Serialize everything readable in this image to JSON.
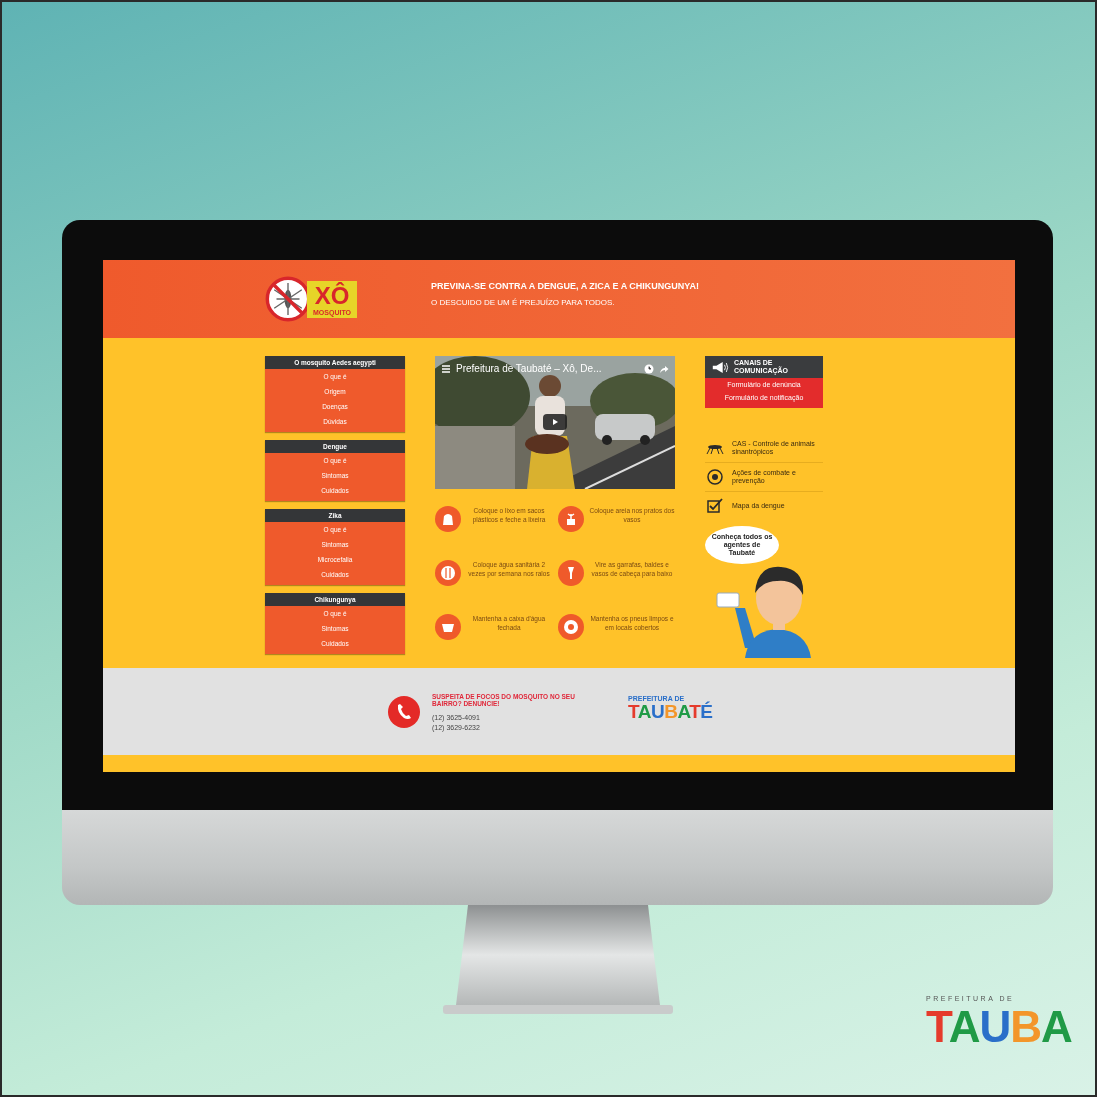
{
  "header": {
    "logo": {
      "title": "XÔ",
      "subtitle": "MOSQUITO"
    },
    "headline": "PREVINA-SE CONTRA A DENGUE, A ZICA E A CHIKUNGUNYA!",
    "tagline": "O DESCUIDO DE UM É PREJUÍZO PARA TODOS."
  },
  "sidebar": {
    "sections": [
      {
        "title": "O mosquito Aedes aegypti",
        "items": [
          "O que é",
          "Origem",
          "Doenças",
          "Dúvidas"
        ]
      },
      {
        "title": "Dengue",
        "items": [
          "O que é",
          "Sintomas",
          "Cuidados"
        ]
      },
      {
        "title": "Zika",
        "items": [
          "O que é",
          "Sintomas",
          "Microcefalia",
          "Cuidados"
        ]
      },
      {
        "title": "Chikungunya",
        "items": [
          "O que é",
          "Sintomas",
          "Cuidados"
        ]
      }
    ]
  },
  "video": {
    "title": "Prefeitura de Taubaté – Xô, De..."
  },
  "tips": [
    {
      "text": "Coloque o lixo em sacos plásticos e feche a lixeira"
    },
    {
      "text": "Coloque areia nos pratos dos vasos"
    },
    {
      "text": "Coloque água sanitária 2 vezes por semana nos ralos"
    },
    {
      "text": "Vire as garrafas, baldes e vasos de cabeça para baixo"
    },
    {
      "text": "Mantenha a caixa d'água fechada"
    },
    {
      "text": "Mantenha os pneus limpos e em locais cobertos"
    }
  ],
  "channels": {
    "title": "CANAIS DE COMUNICAÇÃO",
    "buttons": [
      "Formulário de denúncia",
      "Formulário de notificação"
    ]
  },
  "links": [
    {
      "text": "CAS - Controle de animais sinantrópicos"
    },
    {
      "text": "Ações de combate e prevenção"
    },
    {
      "text": "Mapa da dengue"
    }
  ],
  "agents_bubble": "Conheça todos os agentes de Taubaté",
  "footer": {
    "heading": "SUSPEITA DE FOCOS DO MOSQUITO NO SEU BAIRRO? DENUNCIE!",
    "phones": [
      "(12) 3625-4091",
      "(12) 3629-6232"
    ],
    "logo": {
      "caption": "PREFEITURA DE",
      "wordmark": "TAUBATÉ"
    }
  },
  "brand": {
    "caption": "PREFEITURA DE",
    "wordmark": "TAUBA"
  }
}
